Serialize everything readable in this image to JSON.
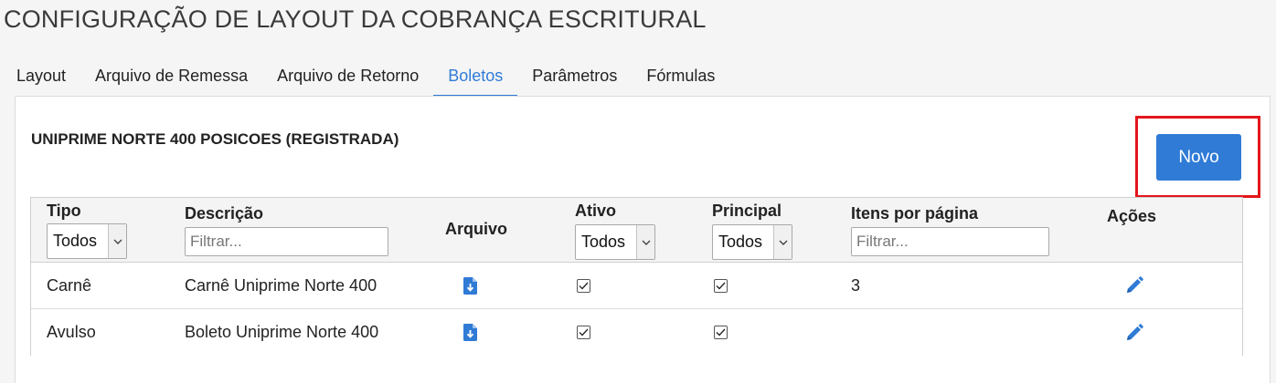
{
  "page": {
    "title": "CONFIGURAÇÃO DE LAYOUT DA COBRANÇA ESCRITURAL"
  },
  "tabs": [
    {
      "label": "Layout",
      "active": false
    },
    {
      "label": "Arquivo de Remessa",
      "active": false
    },
    {
      "label": "Arquivo de Retorno",
      "active": false
    },
    {
      "label": "Boletos",
      "active": true
    },
    {
      "label": "Parâmetros",
      "active": false
    },
    {
      "label": "Fórmulas",
      "active": false
    }
  ],
  "panel": {
    "layout_name": "UNIPRIME NORTE 400 POSICOES (REGISTRADA)",
    "new_button_label": "Novo"
  },
  "grid": {
    "columns": {
      "tipo": {
        "label": "Tipo",
        "filter_value": "Todos"
      },
      "descricao": {
        "label": "Descrição",
        "filter_placeholder": "Filtrar..."
      },
      "arquivo": {
        "label": "Arquivo"
      },
      "ativo": {
        "label": "Ativo",
        "filter_value": "Todos"
      },
      "principal": {
        "label": "Principal",
        "filter_value": "Todos"
      },
      "itens": {
        "label": "Itens por página",
        "filter_placeholder": "Filtrar..."
      },
      "acoes": {
        "label": "Ações"
      }
    },
    "rows": [
      {
        "tipo": "Carnê",
        "descricao": "Carnê Uniprime Norte 400",
        "ativo": true,
        "principal": true,
        "itens": "3"
      },
      {
        "tipo": "Avulso",
        "descricao": "Boleto Uniprime Norte 400",
        "ativo": true,
        "principal": true,
        "itens": ""
      }
    ]
  },
  "icons": {
    "download": "file-download-icon",
    "edit": "pencil-icon",
    "check": "checkmark-icon",
    "dropdown": "chevron-down-icon"
  },
  "colors": {
    "accent": "#2f7bd6",
    "highlight": "#e3161b"
  }
}
